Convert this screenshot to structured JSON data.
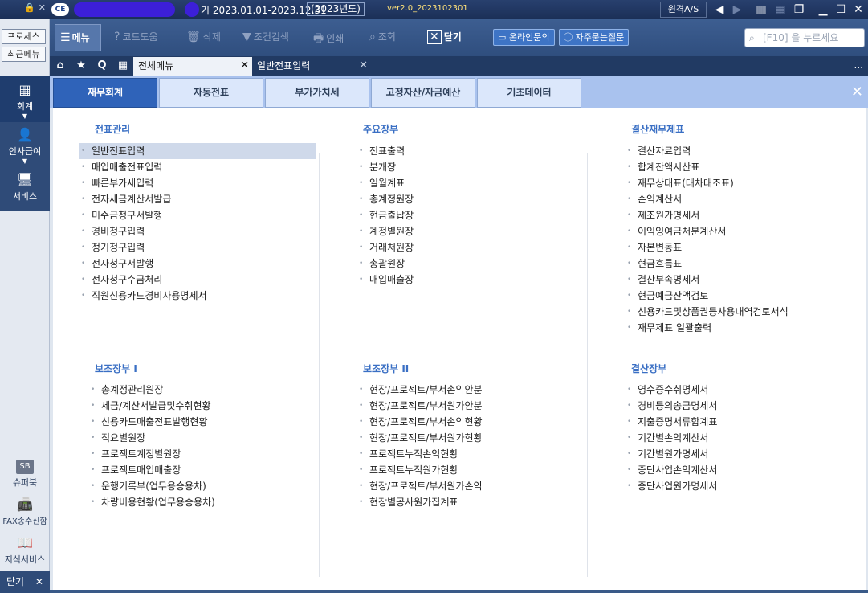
{
  "titlebar": {
    "period": "기  2023.01.01-2023.12.31",
    "year_label": "(2023년도)",
    "version": "ver2.0_2023102301",
    "remote_label": "원격A/S",
    "logo": "CE"
  },
  "leftrail": {
    "process_label": "프로세스",
    "recent_label": "최근메뉴",
    "items": [
      {
        "label": "회계"
      },
      {
        "label": "인사급여"
      },
      {
        "label": "서비스"
      },
      {
        "label": "슈퍼북"
      },
      {
        "label": "FAX송수신함"
      },
      {
        "label": "지식서비스"
      }
    ],
    "close_label": "닫기"
  },
  "toolbar": {
    "menu_label": "메뉴",
    "tools": [
      {
        "label": "코드도움"
      },
      {
        "label": "삭제"
      },
      {
        "label": "조건검색"
      },
      {
        "label": "인쇄"
      },
      {
        "label": "조회"
      },
      {
        "label": "닫기"
      }
    ],
    "online_inquiry": "온라인문의",
    "faq": "자주묻는질문",
    "search_placeholder": "[F10] 을 누르세요"
  },
  "tabs": {
    "all_menu": "전체메뉴",
    "entry": "일반전표입력",
    "more": "..."
  },
  "categories": [
    {
      "label": "재무회계",
      "active": true
    },
    {
      "label": "자동전표"
    },
    {
      "label": "부가가치세"
    },
    {
      "label": "고정자산/자금예산"
    },
    {
      "label": "기초데이터"
    }
  ],
  "sections": {
    "voucher": {
      "title": "전표관리",
      "items": [
        "일반전표입력",
        "매입매출전표입력",
        "빠른부가세입력",
        "전자세금계산서발급",
        "미수금청구서발행",
        "경비청구입력",
        "정기청구입력",
        "전자청구서발행",
        "전자청구수금처리",
        "직원신용카드경비사용명세서"
      ]
    },
    "ledger": {
      "title": "주요장부",
      "items": [
        "전표출력",
        "분개장",
        "일월계표",
        "총계정원장",
        "현금출납장",
        "계정별원장",
        "거래처원장",
        "총괄원장",
        "매입매출장"
      ]
    },
    "closing_fs": {
      "title": "결산재무제표",
      "items": [
        "결산자료입력",
        "합계잔액시산표",
        "재무상태표(대차대조표)",
        "손익계산서",
        "제조원가명세서",
        "이익잉여금처분계산서",
        "자본변동표",
        "현금흐름표",
        "결산부속명세서",
        "현금예금잔액검토",
        "신용카드및상품권등사용내역검토서식",
        "재무제표 일괄출력"
      ]
    },
    "sub1": {
      "title": "보조장부 I",
      "items": [
        "총계정관리원장",
        "세금/계산서발급및수취현황",
        "신용카드매출전표발행현황",
        "적요별원장",
        "프로젝트계정별원장",
        "프로젝트매입매출장",
        "운행기록부(업무용승용차)",
        "차량비용현황(업무용승용차)"
      ]
    },
    "sub2": {
      "title": "보조장부 II",
      "items": [
        "현장/프로젝트/부서손익안분",
        "현장/프로젝트/부서원가안분",
        "현장/프로젝트/부서손익현황",
        "현장/프로젝트/부서원가현황",
        "프로젝트누적손익현황",
        "프로젝트누적원가현황",
        "현장/프로젝트/부서원가손익",
        "현장별공사원가집계표"
      ]
    },
    "closing_book": {
      "title": "결산장부",
      "items": [
        "영수증수취명세서",
        "경비등의송금명세서",
        "지출증명서류합계표",
        "기간별손익계산서",
        "기간별원가명세서",
        "중단사업손익계산서",
        "중단사업원가명세서"
      ]
    }
  }
}
